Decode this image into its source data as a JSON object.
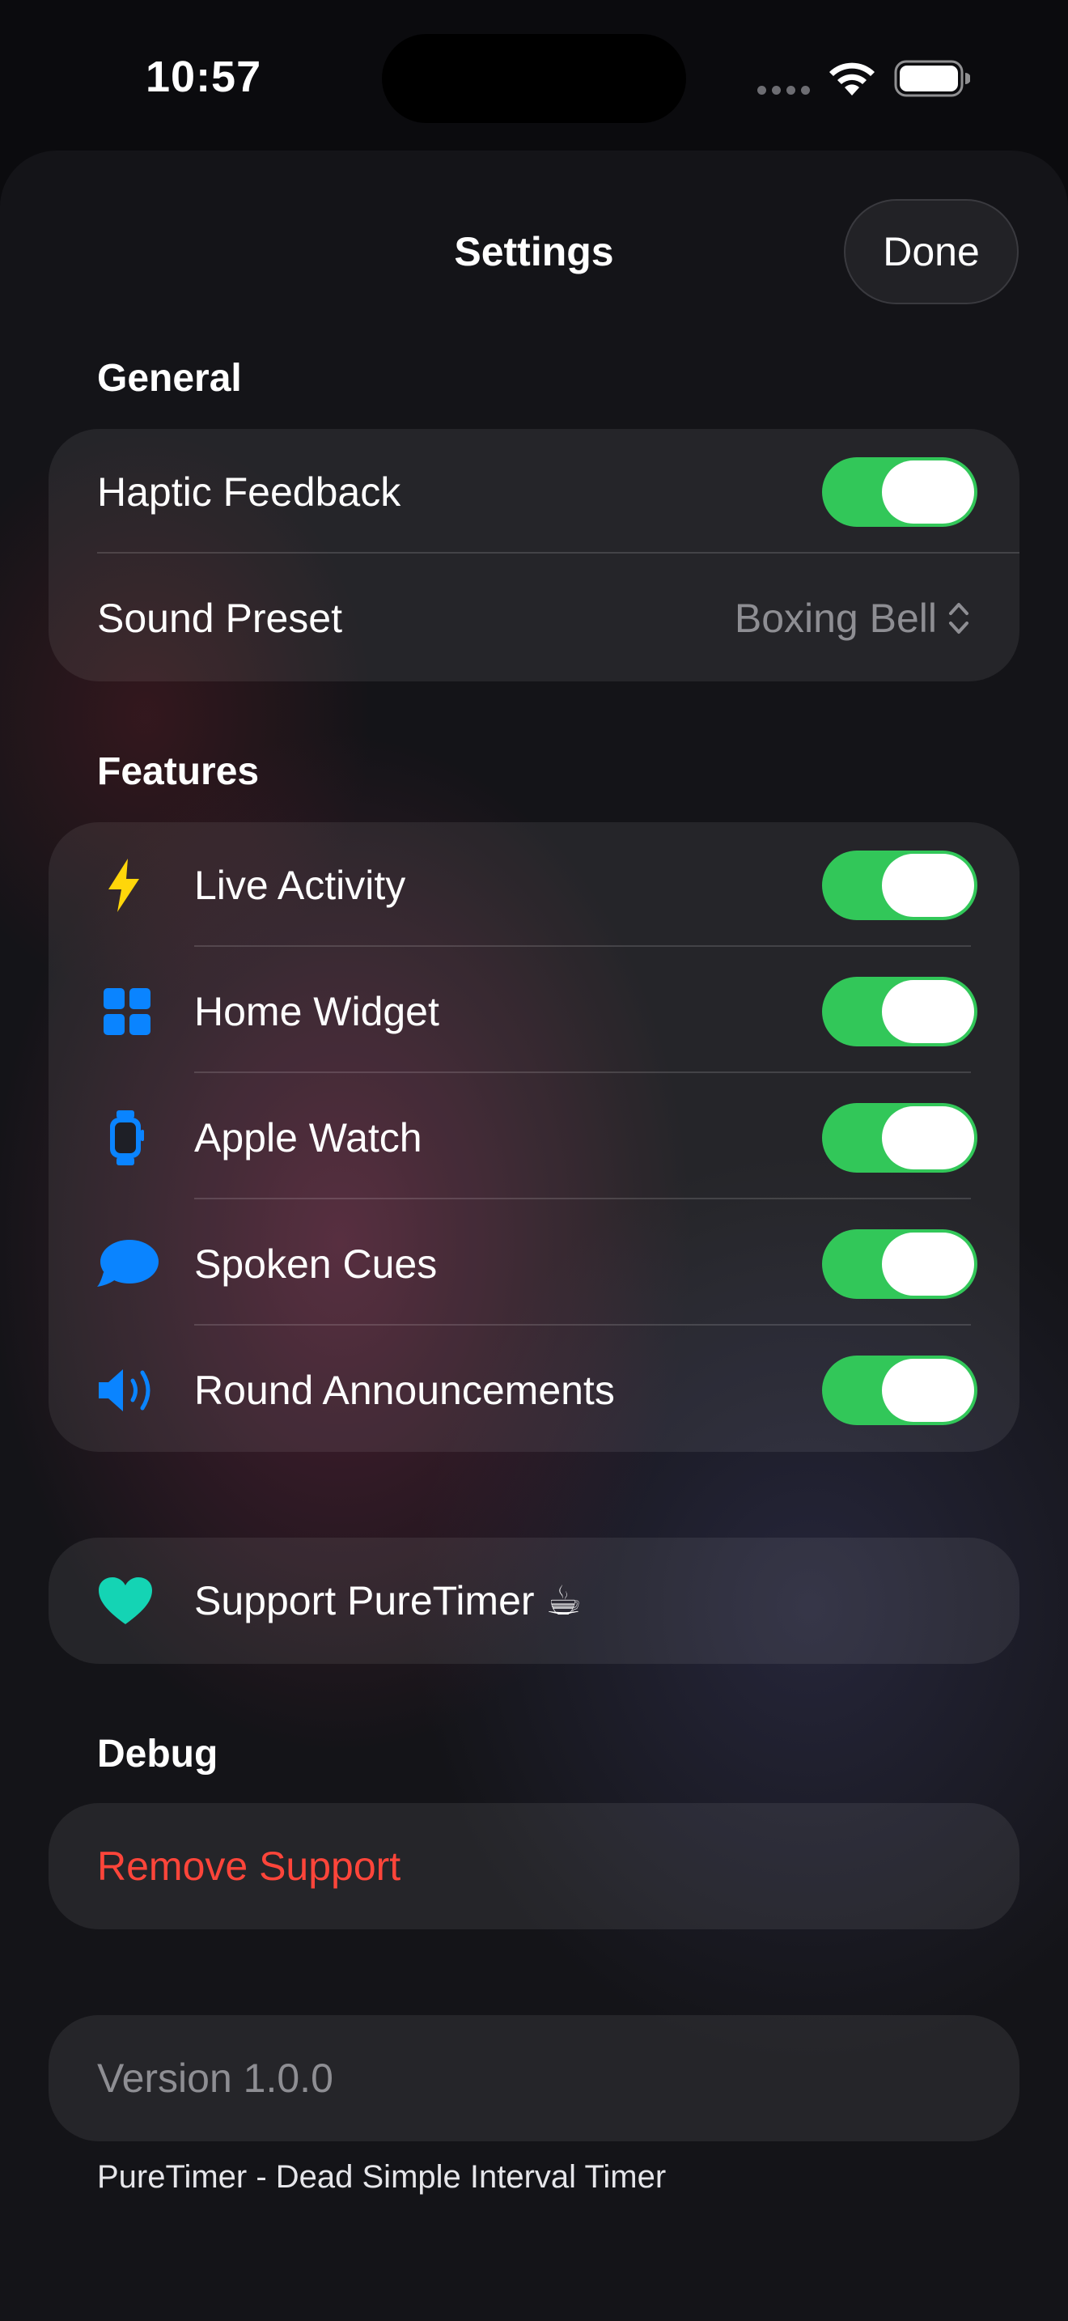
{
  "status_bar": {
    "time": "10:57"
  },
  "header": {
    "title": "Settings",
    "done_label": "Done"
  },
  "general": {
    "header": "General",
    "haptic_label": "Haptic Feedback",
    "haptic_on": true,
    "sound_label": "Sound Preset",
    "sound_value": "Boxing Bell"
  },
  "features": {
    "header": "Features",
    "items": [
      {
        "label": "Live Activity",
        "icon": "bolt-icon",
        "on": true
      },
      {
        "label": "Home Widget",
        "icon": "widget-grid-icon",
        "on": true
      },
      {
        "label": "Apple Watch",
        "icon": "applewatch-icon",
        "on": true
      },
      {
        "label": "Spoken Cues",
        "icon": "speech-bubble-icon",
        "on": true
      },
      {
        "label": "Round Announcements",
        "icon": "speaker-wave-icon",
        "on": true
      }
    ]
  },
  "support": {
    "label": "Support PureTimer ☕",
    "icon": "heart-icon"
  },
  "debug": {
    "header": "Debug",
    "remove_label": "Remove Support"
  },
  "version": {
    "label": "Version 1.0.0"
  },
  "footer": {
    "text": "PureTimer - Dead Simple Interval Timer"
  },
  "colors": {
    "toggle_on": "#32c759",
    "destructive": "#ff453a",
    "accent_blue": "#0a84ff",
    "bolt_yellow": "#ffd60a",
    "heart_teal": "#14d4b4",
    "secondary_text": "#8e8e93"
  }
}
